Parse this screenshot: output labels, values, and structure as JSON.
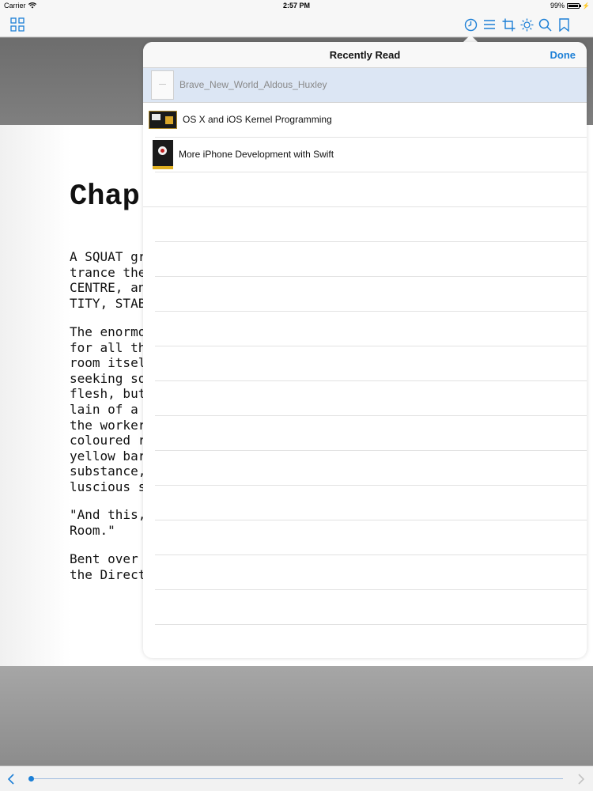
{
  "status_bar": {
    "carrier": "Carrier",
    "time": "2:57 PM",
    "battery": "99%"
  },
  "toolbar": {
    "icons": [
      "grid-icon",
      "clock-icon",
      "list-icon",
      "crop-icon",
      "brightness-icon",
      "search-icon",
      "bookmark-icon"
    ],
    "accent": "#1c7fd6"
  },
  "reader": {
    "chapter_title": "Chap",
    "paragraphs": [
      "A SQUAT gr\ntrance the w\nCENTRE, an\nTITY, STABI",
      "The enormo\nfor all the s\nroom itself,\nseeking son\nflesh, but fi\nlain of a lab\nthe workers\ncoloured ru\nyellow barre\nsubstance,\nluscious str",
      "\"And this,\"\nRoom.\"",
      "Bent over th\nthe Director"
    ]
  },
  "popover": {
    "title": "Recently Read",
    "done_label": "Done",
    "items": [
      {
        "label": "Brave_New_World_Aldous_Huxley",
        "selected": true
      },
      {
        "label": "OS X and iOS Kernel Programming",
        "selected": false
      },
      {
        "label": "More iPhone Development with Swift",
        "selected": false
      }
    ],
    "empty_rows": 14
  },
  "navigation": {
    "prev_icon": "chevron-left-icon",
    "next_icon": "chevron-right-icon",
    "progress": 0.0
  }
}
